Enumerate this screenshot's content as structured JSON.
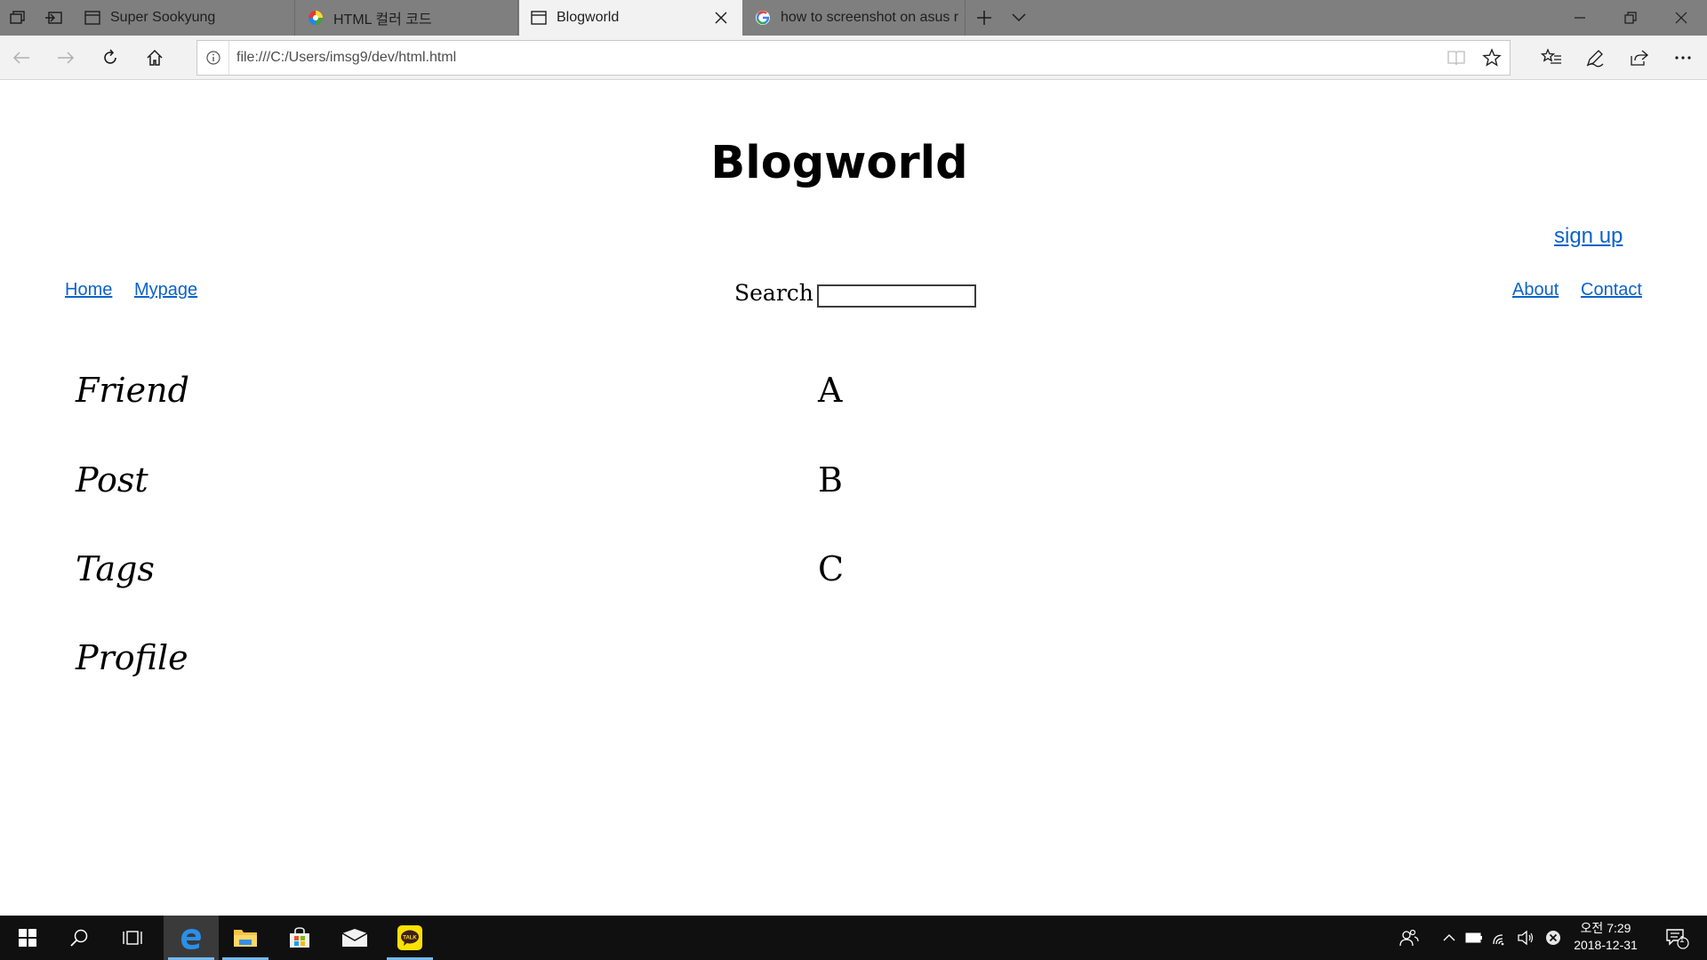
{
  "browser": {
    "tabs": [
      {
        "title": "Super Sookyung",
        "favicon": "page-icon"
      },
      {
        "title": "HTML 컬러 코드",
        "favicon": "color-wheel-icon"
      },
      {
        "title": "Blogworld",
        "favicon": "page-icon",
        "active": true
      },
      {
        "title": "how to screenshot on asus r",
        "favicon": "google-icon"
      }
    ],
    "url": "file:///C:/Users/imsg9/dev/html.html"
  },
  "page": {
    "title": "Blogworld",
    "signup": "sign up",
    "nav_left": [
      "Home",
      "Mypage"
    ],
    "search_label": "Search",
    "search_value": "",
    "nav_right": [
      "About",
      "Contact"
    ],
    "sidebar": [
      "Friend",
      "Post",
      "Tags",
      "Profile"
    ],
    "content": [
      "A",
      "B",
      "C"
    ]
  },
  "taskbar": {
    "apps": [
      "start-icon",
      "search-icon",
      "task-view-icon",
      "edge-icon",
      "file-explorer-icon",
      "store-icon",
      "mail-icon",
      "kakaotalk-icon"
    ],
    "clock_period": "오전 7:29",
    "clock_date": "2018-12-31",
    "notification_count": "1"
  },
  "colors": {
    "link": "#0b63c9",
    "tabstrip": "#7f7f7f",
    "taskbar": "#101010",
    "taskbar_accent": "#76b9ed"
  }
}
